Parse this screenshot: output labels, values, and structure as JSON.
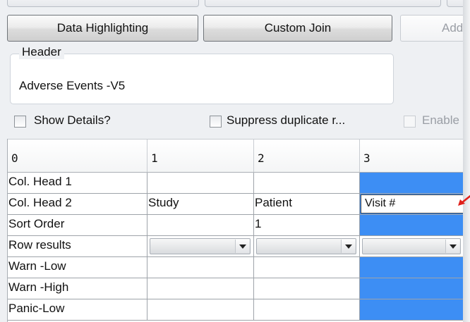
{
  "toolbar": {
    "data_highlighting_label": "Data Highlighting",
    "custom_join_label": "Custom Join",
    "add_label": "Add I"
  },
  "header_group": {
    "legend": "Header",
    "value": "Adverse Events -V5"
  },
  "options": {
    "show_details_label": "Show Details?",
    "suppress_duplicate_label": "Suppress duplicate r...",
    "enable_label": "Enable"
  },
  "grid": {
    "columns": [
      "0",
      "1",
      "2",
      "3"
    ],
    "rows": [
      {
        "label": "Col. Head 1",
        "c1": "",
        "c2": "",
        "c3": ""
      },
      {
        "label": "Col. Head 2",
        "c1": "Study",
        "c2": "Patient",
        "c3": "Visit #"
      },
      {
        "label": "Sort Order",
        "c1": "",
        "c2": "1",
        "c3": ""
      },
      {
        "label": "Row results",
        "c1": "",
        "c2": "",
        "c3": ""
      },
      {
        "label": "Warn -Low",
        "c1": "",
        "c2": "",
        "c3": ""
      },
      {
        "label": "Warn -High",
        "c1": "",
        "c2": "",
        "c3": ""
      },
      {
        "label": "Panic-Low",
        "c1": "",
        "c2": "",
        "c3": ""
      }
    ]
  },
  "colors": {
    "selection": "#3d8ef4",
    "annotation_arrow": "#e0201b"
  }
}
